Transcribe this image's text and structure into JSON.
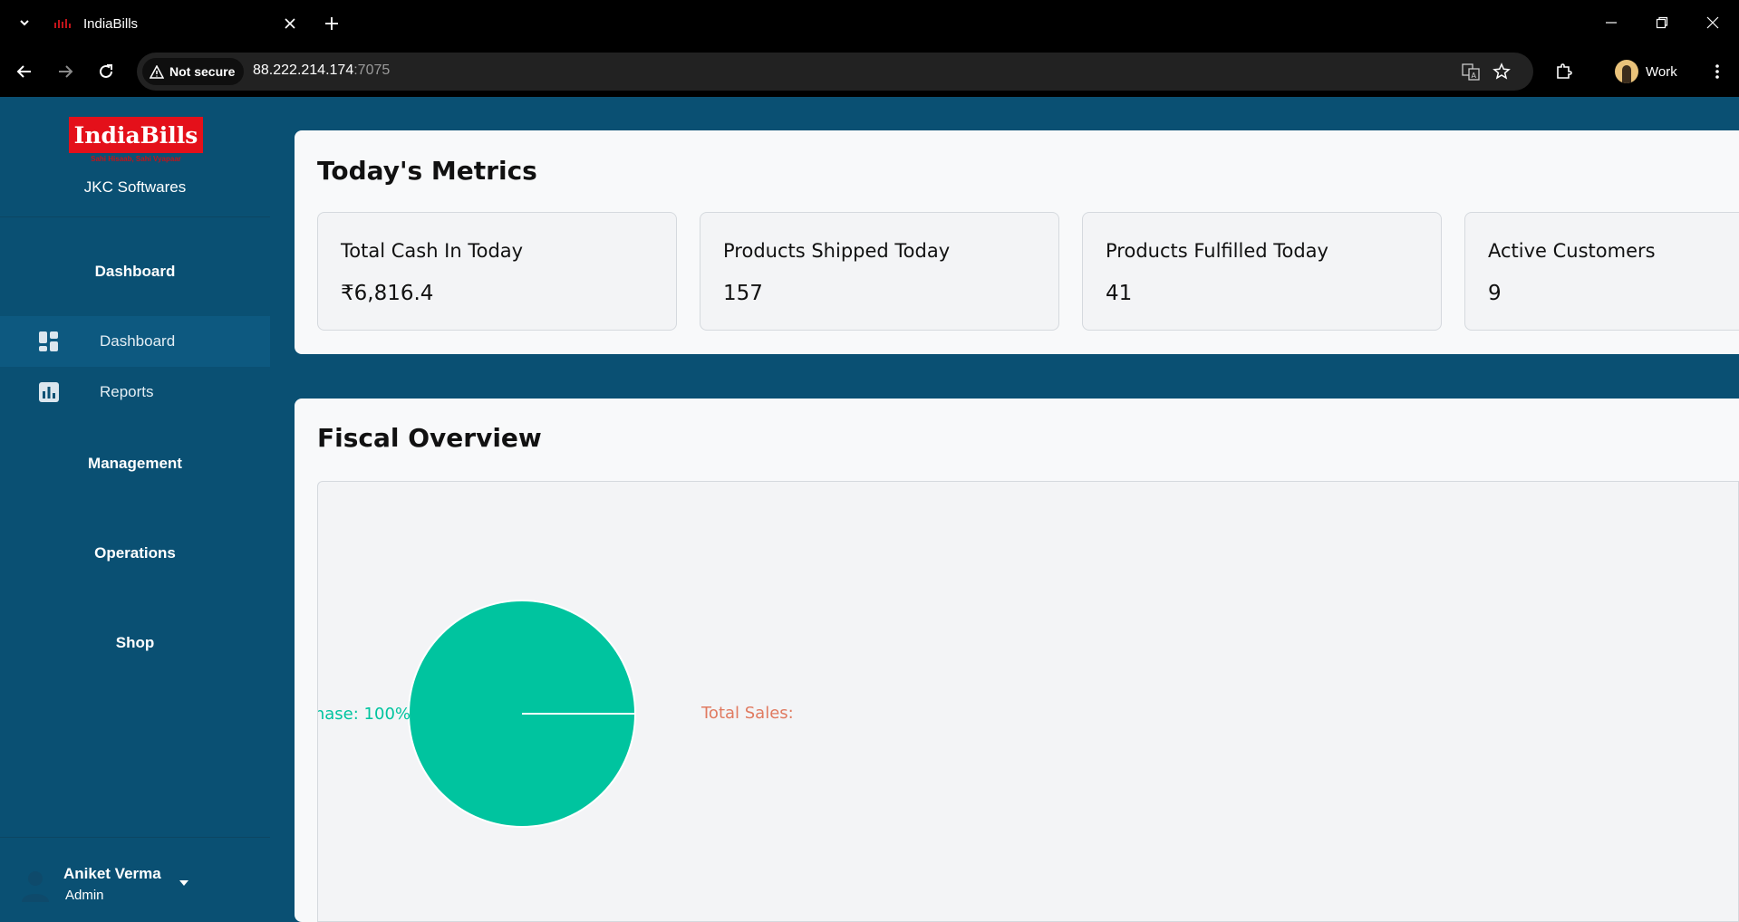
{
  "browser": {
    "tab_title": "IndiaBills",
    "security_label": "Not secure",
    "url_host": "88.222.214.174",
    "url_port": ":7075",
    "profile_name": "Work"
  },
  "sidebar": {
    "logo_text": "IndiaBills",
    "logo_tagline": "Sahi Hisaab, Sahi Vyapaar",
    "company": "JKC Softwares",
    "sections": {
      "dashboard": "Dashboard",
      "management": "Management",
      "operations": "Operations",
      "shop": "Shop"
    },
    "items": [
      {
        "label": "Dashboard",
        "icon": "dashboard-icon",
        "active": true
      },
      {
        "label": "Reports",
        "icon": "bar-chart-icon",
        "active": false
      }
    ],
    "user": {
      "name": "Aniket Verma",
      "role": "Admin"
    }
  },
  "metrics": {
    "title": "Today's Metrics",
    "cards": [
      {
        "label": "Total Cash In Today",
        "value": "₹6,816.4"
      },
      {
        "label": "Products Shipped Today",
        "value": "157"
      },
      {
        "label": "Products Fulfilled Today",
        "value": "41"
      },
      {
        "label": "Active Customers",
        "value": "9"
      }
    ]
  },
  "fiscal": {
    "title": "Fiscal Overview"
  },
  "chart_data": {
    "type": "pie",
    "categories": [
      "Total Purchase",
      "Total Sales"
    ],
    "values": [
      100,
      0
    ],
    "labels": [
      "hase: 100%",
      "Total Sales:"
    ],
    "colors": [
      "#00c49f",
      "#ff8042"
    ],
    "label_colors": [
      "#00c49f",
      "#e07a60"
    ]
  },
  "colors": {
    "sidebar": "#0a5073",
    "accent": "#00c49f",
    "logo_red": "#e4101a"
  }
}
